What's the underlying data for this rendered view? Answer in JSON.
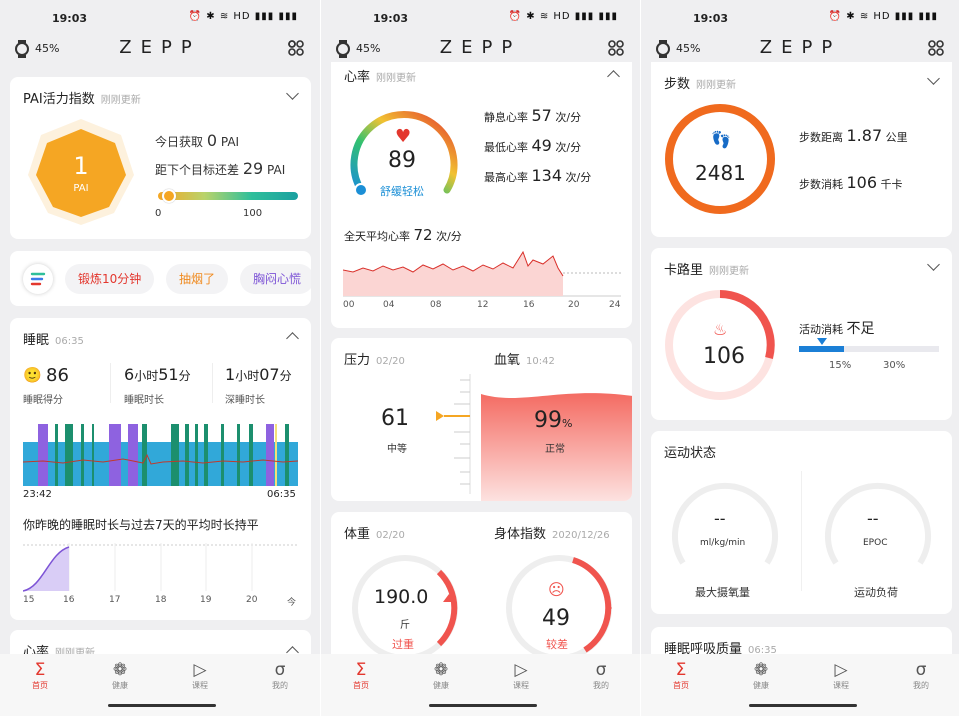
{
  "status": {
    "time": "19:03",
    "icons": "⏰ ✱ ≋ HD ▮▮▮ ▮▮▮"
  },
  "header": {
    "battery": "45%",
    "logo": "ZEPP"
  },
  "tabbar": {
    "items": [
      {
        "label": "首页",
        "icon": "Σ"
      },
      {
        "label": "健康",
        "icon": "❁"
      },
      {
        "label": "课程",
        "icon": "▷"
      },
      {
        "label": "我的",
        "icon": "σ"
      }
    ]
  },
  "pai": {
    "title": "PAI活力指数",
    "updated": "刚刚更新",
    "value": "1",
    "unit": "PAI",
    "today_label": "今日获取",
    "today_value": "0",
    "today_unit": "PAI",
    "target_label": "距下个目标还差",
    "target_value": "29",
    "target_unit": "PAI",
    "bar_min": "0",
    "bar_max": "100",
    "progress": 0.04
  },
  "shortcuts": {
    "chips": [
      "锻炼10分钟",
      "抽烟了",
      "胸闷心慌"
    ]
  },
  "sleep": {
    "title": "睡眠",
    "time": "06:35",
    "score": "86",
    "score_label": "睡眠得分",
    "duration_h": "6",
    "duration_m": "51",
    "duration_label": "睡眠时长",
    "deep_h": "1",
    "deep_m": "07",
    "deep_label": "深睡时长",
    "hour_unit": "小时",
    "min_unit": "分",
    "start": "23:42",
    "end": "06:35",
    "compare_text": "你昨晚的睡眠时长与过去7天的平均时长持平",
    "axis": [
      "15",
      "16",
      "17",
      "18",
      "19",
      "20",
      "今"
    ]
  },
  "hr_peek": {
    "title": "心率",
    "updated": "刚刚更新"
  },
  "heart": {
    "title": "心率",
    "updated": "刚刚更新",
    "value": "89",
    "status": "舒缓轻松",
    "resting_label": "静息心率",
    "resting": "57",
    "min_label": "最低心率",
    "min": "49",
    "max_label": "最高心率",
    "max": "134",
    "unit": "次/分",
    "avg_label": "全天平均心率",
    "avg": "72",
    "axis": [
      "00",
      "04",
      "08",
      "12",
      "16",
      "20",
      "24"
    ]
  },
  "stress": {
    "title": "压力",
    "date": "02/20",
    "value": "61",
    "level": "中等"
  },
  "spo2": {
    "title": "血氧",
    "time": "10:42",
    "value": "99",
    "unit": "%",
    "status": "正常"
  },
  "weight": {
    "title": "体重",
    "date": "02/20",
    "value": "190.0",
    "unit": "斤",
    "status": "过重"
  },
  "body": {
    "title": "身体指数",
    "date": "2020/12/26",
    "value": "49",
    "status": "较差"
  },
  "steps": {
    "title": "步数",
    "updated": "刚刚更新",
    "value": "2481",
    "distance_label": "步数距离",
    "distance": "1.87",
    "distance_unit": "公里",
    "cal_label": "步数消耗",
    "cal": "106",
    "cal_unit": "千卡"
  },
  "calories": {
    "title": "卡路里",
    "updated": "刚刚更新",
    "value": "106",
    "activity_label": "活动消耗",
    "activity_status": "不足",
    "mark1": "15%",
    "mark2": "30%"
  },
  "sport": {
    "title": "运动状态",
    "vo2_value": "--",
    "vo2_unit": "ml/kg/min",
    "vo2_label": "最大摄氧量",
    "epoc_value": "--",
    "epoc_unit": "EPOC",
    "epoc_label": "运动负荷"
  },
  "breath": {
    "title": "睡眠呼吸质量",
    "time": "06:35"
  },
  "colors": {
    "accent": "#e3372e",
    "pai": "#f5a623",
    "steps": "#f06a1e",
    "cal": "#f0544e",
    "sleep_blue": "#31a8d9",
    "sleep_green": "#1c8f6e",
    "sleep_purple": "#8e62e0"
  }
}
